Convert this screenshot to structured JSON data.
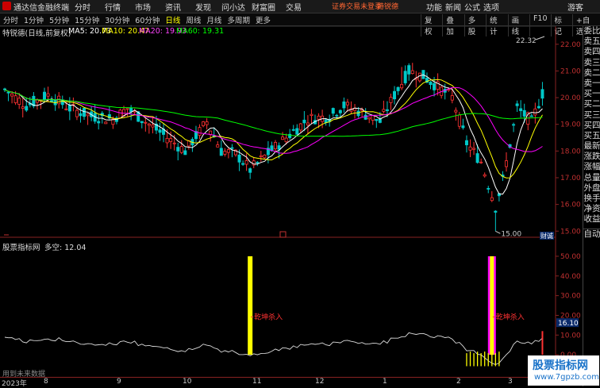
{
  "topbar": {
    "app_name": "通达信金融终端",
    "menu": [
      "分时",
      "行情",
      "市场",
      "资讯",
      "发现",
      "问小达",
      "财富圈",
      "交易"
    ],
    "login_hint": "证券交易未登录",
    "stock_name": "特锐德",
    "right_menu": [
      "功能",
      "新闻",
      "公式",
      "选项"
    ],
    "guest": "游客"
  },
  "periodbar": {
    "periods": [
      "分时",
      "1分钟",
      "5分钟",
      "15分钟",
      "30分钟",
      "60分钟",
      "日线",
      "周线",
      "月线",
      "多周期",
      "更多"
    ],
    "active": "日线",
    "tools": [
      "复权",
      "叠加",
      "多股",
      "统计",
      "画线",
      "F10",
      "标记",
      "+自选"
    ]
  },
  "infobar": {
    "title": "特锐德(日线,前复权)",
    "ma5": "MA5: 20.73",
    "ma10": "MA10: 20.47",
    "ma20": "MA20: 19.93",
    "ma60": "MA60: 19.31"
  },
  "price_axis": {
    "labels": [
      "22.00",
      "21.00",
      "20.00",
      "19.00",
      "18.00",
      "17.00",
      "16.00",
      "15.00"
    ],
    "high_label": "22.32",
    "low_label": "15.00"
  },
  "indicator": {
    "name": "股票指标网",
    "value": "多空: 12.04",
    "signal_label": "乾坤杀入",
    "current_value": "16.10",
    "axis_labels": [
      "50.00",
      "40.00",
      "30.00",
      "20.00",
      "10.00",
      "0.00"
    ]
  },
  "side_panel": [
    "委比",
    "卖五",
    "卖四",
    "卖三",
    "卖二",
    "卖一",
    "买一",
    "买二",
    "买三",
    "买四",
    "买五",
    "最新",
    "涨跌",
    "涨幅",
    "总量",
    "外盘",
    "换手",
    "净资",
    "收益",
    "自动"
  ],
  "bottom_note": "用到未来数据",
  "dates": {
    "year": "2023年",
    "m8": "8",
    "m9": "9",
    "m10": "10",
    "m11": "11",
    "m12": "12",
    "m1": "1",
    "m2": "2",
    "m3": "3"
  },
  "corner_label": "财诚",
  "watermark": {
    "line1": "股票指标网",
    "line2": "www.7gpzb.com"
  },
  "colors": {
    "up": "#ff3232",
    "down": "#00c8c8",
    "ma5": "#ffffff",
    "ma10": "#ffff00",
    "ma20": "#ff00ff",
    "ma60": "#00ff00",
    "signal": "#ffff00"
  }
}
